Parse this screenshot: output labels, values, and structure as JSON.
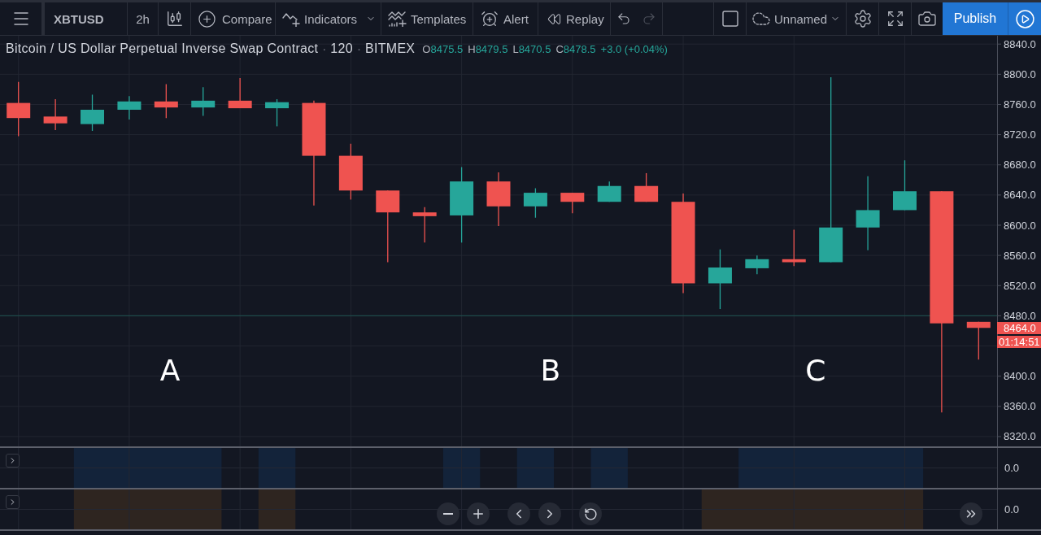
{
  "toolbar": {
    "symbol": "XBTUSD",
    "interval": "2h",
    "compare": "Compare",
    "indicators": "Indicators",
    "templates": "Templates",
    "alert": "Alert",
    "replay": "Replay",
    "undo": {
      "disabled": false
    },
    "redo": {
      "disabled": true
    },
    "layout_name": "Unnamed",
    "publish": "Publish"
  },
  "chart": {
    "legend": {
      "items": [
        {
          "kind": "text",
          "text": "Bitcoin / US Dollar Perpetual Inverse Swap Contract"
        },
        {
          "kind": "separator",
          "text": "·"
        },
        {
          "kind": "text",
          "text": "120"
        },
        {
          "kind": "separator",
          "text": "·"
        },
        {
          "kind": "text",
          "text": "BITMEX"
        }
      ],
      "ohlc": [
        {
          "label": "O",
          "value": "8475.5"
        },
        {
          "label": "H",
          "value": "8479.5"
        },
        {
          "label": "L",
          "value": "8470.5"
        },
        {
          "label": "C",
          "value": "8478.5"
        }
      ],
      "change": "+3.0 (+0.04%)",
      "falling": false
    },
    "chart_data": [
      {
        "type": "candlestick",
        "categories": [
          null,
          null,
          null,
          null,
          null,
          null,
          null,
          null,
          null,
          null,
          null,
          null,
          null,
          null,
          null,
          null,
          null,
          null,
          null,
          null,
          null,
          null,
          null,
          null,
          null,
          null,
          null
        ],
        "ohlc": [
          [
            8762,
            8790,
            8718,
            8742
          ],
          [
            8744,
            8767,
            8726,
            8735
          ],
          [
            8734,
            8773,
            8725,
            8753
          ],
          [
            8753,
            8771,
            8740,
            8764
          ],
          [
            8764,
            8787,
            8742,
            8756
          ],
          [
            8756,
            8783,
            8745,
            8765
          ],
          [
            8765,
            8795,
            8755,
            8755
          ],
          [
            8755,
            8767,
            8731,
            8763
          ],
          [
            8762,
            8765,
            8626,
            8692
          ],
          [
            8692,
            8708,
            8634,
            8646
          ],
          [
            8646,
            8646,
            8551,
            8617
          ],
          [
            8617,
            8624,
            8577,
            8612
          ],
          [
            8613,
            8677,
            8577,
            8658
          ],
          [
            8658,
            8670,
            8599,
            8625
          ],
          [
            8625,
            8649,
            8610,
            8643
          ],
          [
            8643,
            8643,
            8616,
            8631
          ],
          [
            8631,
            8658,
            8631,
            8652
          ],
          [
            8652,
            8669,
            8631,
            8631
          ],
          [
            8631,
            8642,
            8510,
            8523
          ],
          [
            8523,
            8568,
            8489,
            8544
          ],
          [
            8543,
            8560,
            8535,
            8555
          ],
          [
            8555,
            8594,
            8546,
            8551
          ],
          [
            8551,
            8796,
            8551,
            8597
          ],
          [
            8597,
            8665,
            8567,
            8620
          ],
          [
            8620,
            8686,
            8620,
            8645
          ],
          [
            8645,
            8645,
            8352,
            8470
          ],
          [
            8472,
            8472,
            8422,
            8464
          ]
        ],
        "ylim": [
          8307,
          8851
        ],
        "yticks": [
          {
            "value": 8320,
            "label": "8320.0"
          },
          {
            "value": 8360,
            "label": "8360.0"
          },
          {
            "value": 8400,
            "label": "8400.0"
          },
          {
            "value": 8480,
            "label": "8480.0"
          },
          {
            "value": 8520,
            "label": "8520.0"
          },
          {
            "value": 8560,
            "label": "8560.0"
          },
          {
            "value": 8600,
            "label": "8600.0"
          },
          {
            "value": 8640,
            "label": "8640.0"
          },
          {
            "value": 8680,
            "label": "8680.0"
          },
          {
            "value": 8720,
            "label": "8720.0"
          },
          {
            "value": 8760,
            "label": "8760.0"
          },
          {
            "value": 8800,
            "label": "8800.0"
          },
          {
            "value": 8840,
            "label": "8840.0"
          }
        ],
        "tick_labels": "y",
        "grid": true,
        "ref_lines": [
          {
            "axis": "y",
            "value": 8480,
            "color": "#1e4a49"
          }
        ],
        "annotations": [
          "A",
          "B",
          "C"
        ]
      }
    ],
    "last_price": {
      "value": "8464.0",
      "countdown": "01:14:51",
      "falling": true
    }
  },
  "indicator_panes": [
    {
      "scale_label": "0.0"
    },
    {
      "scale_label": "0.0"
    }
  ]
}
